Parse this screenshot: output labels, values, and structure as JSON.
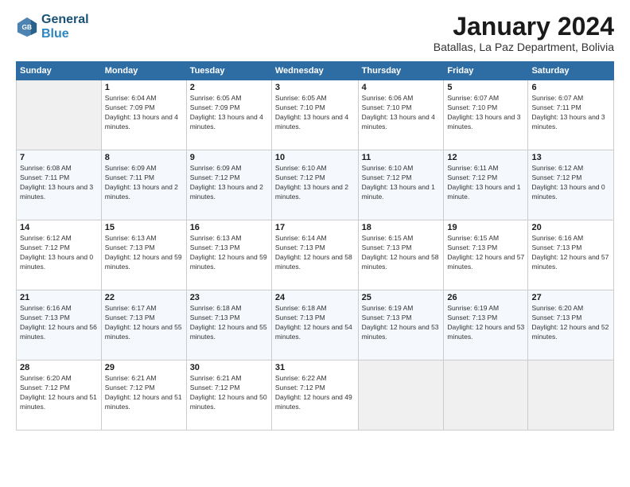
{
  "header": {
    "logo_line1": "General",
    "logo_line2": "Blue",
    "month_title": "January 2024",
    "subtitle": "Batallas, La Paz Department, Bolivia"
  },
  "weekdays": [
    "Sunday",
    "Monday",
    "Tuesday",
    "Wednesday",
    "Thursday",
    "Friday",
    "Saturday"
  ],
  "weeks": [
    [
      {
        "num": "",
        "sunrise": "",
        "sunset": "",
        "daylight": "",
        "empty": true
      },
      {
        "num": "1",
        "sunrise": "Sunrise: 6:04 AM",
        "sunset": "Sunset: 7:09 PM",
        "daylight": "Daylight: 13 hours and 4 minutes."
      },
      {
        "num": "2",
        "sunrise": "Sunrise: 6:05 AM",
        "sunset": "Sunset: 7:09 PM",
        "daylight": "Daylight: 13 hours and 4 minutes."
      },
      {
        "num": "3",
        "sunrise": "Sunrise: 6:05 AM",
        "sunset": "Sunset: 7:10 PM",
        "daylight": "Daylight: 13 hours and 4 minutes."
      },
      {
        "num": "4",
        "sunrise": "Sunrise: 6:06 AM",
        "sunset": "Sunset: 7:10 PM",
        "daylight": "Daylight: 13 hours and 4 minutes."
      },
      {
        "num": "5",
        "sunrise": "Sunrise: 6:07 AM",
        "sunset": "Sunset: 7:10 PM",
        "daylight": "Daylight: 13 hours and 3 minutes."
      },
      {
        "num": "6",
        "sunrise": "Sunrise: 6:07 AM",
        "sunset": "Sunset: 7:11 PM",
        "daylight": "Daylight: 13 hours and 3 minutes."
      }
    ],
    [
      {
        "num": "7",
        "sunrise": "Sunrise: 6:08 AM",
        "sunset": "Sunset: 7:11 PM",
        "daylight": "Daylight: 13 hours and 3 minutes."
      },
      {
        "num": "8",
        "sunrise": "Sunrise: 6:09 AM",
        "sunset": "Sunset: 7:11 PM",
        "daylight": "Daylight: 13 hours and 2 minutes."
      },
      {
        "num": "9",
        "sunrise": "Sunrise: 6:09 AM",
        "sunset": "Sunset: 7:12 PM",
        "daylight": "Daylight: 13 hours and 2 minutes."
      },
      {
        "num": "10",
        "sunrise": "Sunrise: 6:10 AM",
        "sunset": "Sunset: 7:12 PM",
        "daylight": "Daylight: 13 hours and 2 minutes."
      },
      {
        "num": "11",
        "sunrise": "Sunrise: 6:10 AM",
        "sunset": "Sunset: 7:12 PM",
        "daylight": "Daylight: 13 hours and 1 minute."
      },
      {
        "num": "12",
        "sunrise": "Sunrise: 6:11 AM",
        "sunset": "Sunset: 7:12 PM",
        "daylight": "Daylight: 13 hours and 1 minute."
      },
      {
        "num": "13",
        "sunrise": "Sunrise: 6:12 AM",
        "sunset": "Sunset: 7:12 PM",
        "daylight": "Daylight: 13 hours and 0 minutes."
      }
    ],
    [
      {
        "num": "14",
        "sunrise": "Sunrise: 6:12 AM",
        "sunset": "Sunset: 7:12 PM",
        "daylight": "Daylight: 13 hours and 0 minutes."
      },
      {
        "num": "15",
        "sunrise": "Sunrise: 6:13 AM",
        "sunset": "Sunset: 7:13 PM",
        "daylight": "Daylight: 12 hours and 59 minutes."
      },
      {
        "num": "16",
        "sunrise": "Sunrise: 6:13 AM",
        "sunset": "Sunset: 7:13 PM",
        "daylight": "Daylight: 12 hours and 59 minutes."
      },
      {
        "num": "17",
        "sunrise": "Sunrise: 6:14 AM",
        "sunset": "Sunset: 7:13 PM",
        "daylight": "Daylight: 12 hours and 58 minutes."
      },
      {
        "num": "18",
        "sunrise": "Sunrise: 6:15 AM",
        "sunset": "Sunset: 7:13 PM",
        "daylight": "Daylight: 12 hours and 58 minutes."
      },
      {
        "num": "19",
        "sunrise": "Sunrise: 6:15 AM",
        "sunset": "Sunset: 7:13 PM",
        "daylight": "Daylight: 12 hours and 57 minutes."
      },
      {
        "num": "20",
        "sunrise": "Sunrise: 6:16 AM",
        "sunset": "Sunset: 7:13 PM",
        "daylight": "Daylight: 12 hours and 57 minutes."
      }
    ],
    [
      {
        "num": "21",
        "sunrise": "Sunrise: 6:16 AM",
        "sunset": "Sunset: 7:13 PM",
        "daylight": "Daylight: 12 hours and 56 minutes."
      },
      {
        "num": "22",
        "sunrise": "Sunrise: 6:17 AM",
        "sunset": "Sunset: 7:13 PM",
        "daylight": "Daylight: 12 hours and 55 minutes."
      },
      {
        "num": "23",
        "sunrise": "Sunrise: 6:18 AM",
        "sunset": "Sunset: 7:13 PM",
        "daylight": "Daylight: 12 hours and 55 minutes."
      },
      {
        "num": "24",
        "sunrise": "Sunrise: 6:18 AM",
        "sunset": "Sunset: 7:13 PM",
        "daylight": "Daylight: 12 hours and 54 minutes."
      },
      {
        "num": "25",
        "sunrise": "Sunrise: 6:19 AM",
        "sunset": "Sunset: 7:13 PM",
        "daylight": "Daylight: 12 hours and 53 minutes."
      },
      {
        "num": "26",
        "sunrise": "Sunrise: 6:19 AM",
        "sunset": "Sunset: 7:13 PM",
        "daylight": "Daylight: 12 hours and 53 minutes."
      },
      {
        "num": "27",
        "sunrise": "Sunrise: 6:20 AM",
        "sunset": "Sunset: 7:13 PM",
        "daylight": "Daylight: 12 hours and 52 minutes."
      }
    ],
    [
      {
        "num": "28",
        "sunrise": "Sunrise: 6:20 AM",
        "sunset": "Sunset: 7:12 PM",
        "daylight": "Daylight: 12 hours and 51 minutes."
      },
      {
        "num": "29",
        "sunrise": "Sunrise: 6:21 AM",
        "sunset": "Sunset: 7:12 PM",
        "daylight": "Daylight: 12 hours and 51 minutes."
      },
      {
        "num": "30",
        "sunrise": "Sunrise: 6:21 AM",
        "sunset": "Sunset: 7:12 PM",
        "daylight": "Daylight: 12 hours and 50 minutes."
      },
      {
        "num": "31",
        "sunrise": "Sunrise: 6:22 AM",
        "sunset": "Sunset: 7:12 PM",
        "daylight": "Daylight: 12 hours and 49 minutes."
      },
      {
        "num": "",
        "sunrise": "",
        "sunset": "",
        "daylight": "",
        "empty": true
      },
      {
        "num": "",
        "sunrise": "",
        "sunset": "",
        "daylight": "",
        "empty": true
      },
      {
        "num": "",
        "sunrise": "",
        "sunset": "",
        "daylight": "",
        "empty": true
      }
    ]
  ]
}
